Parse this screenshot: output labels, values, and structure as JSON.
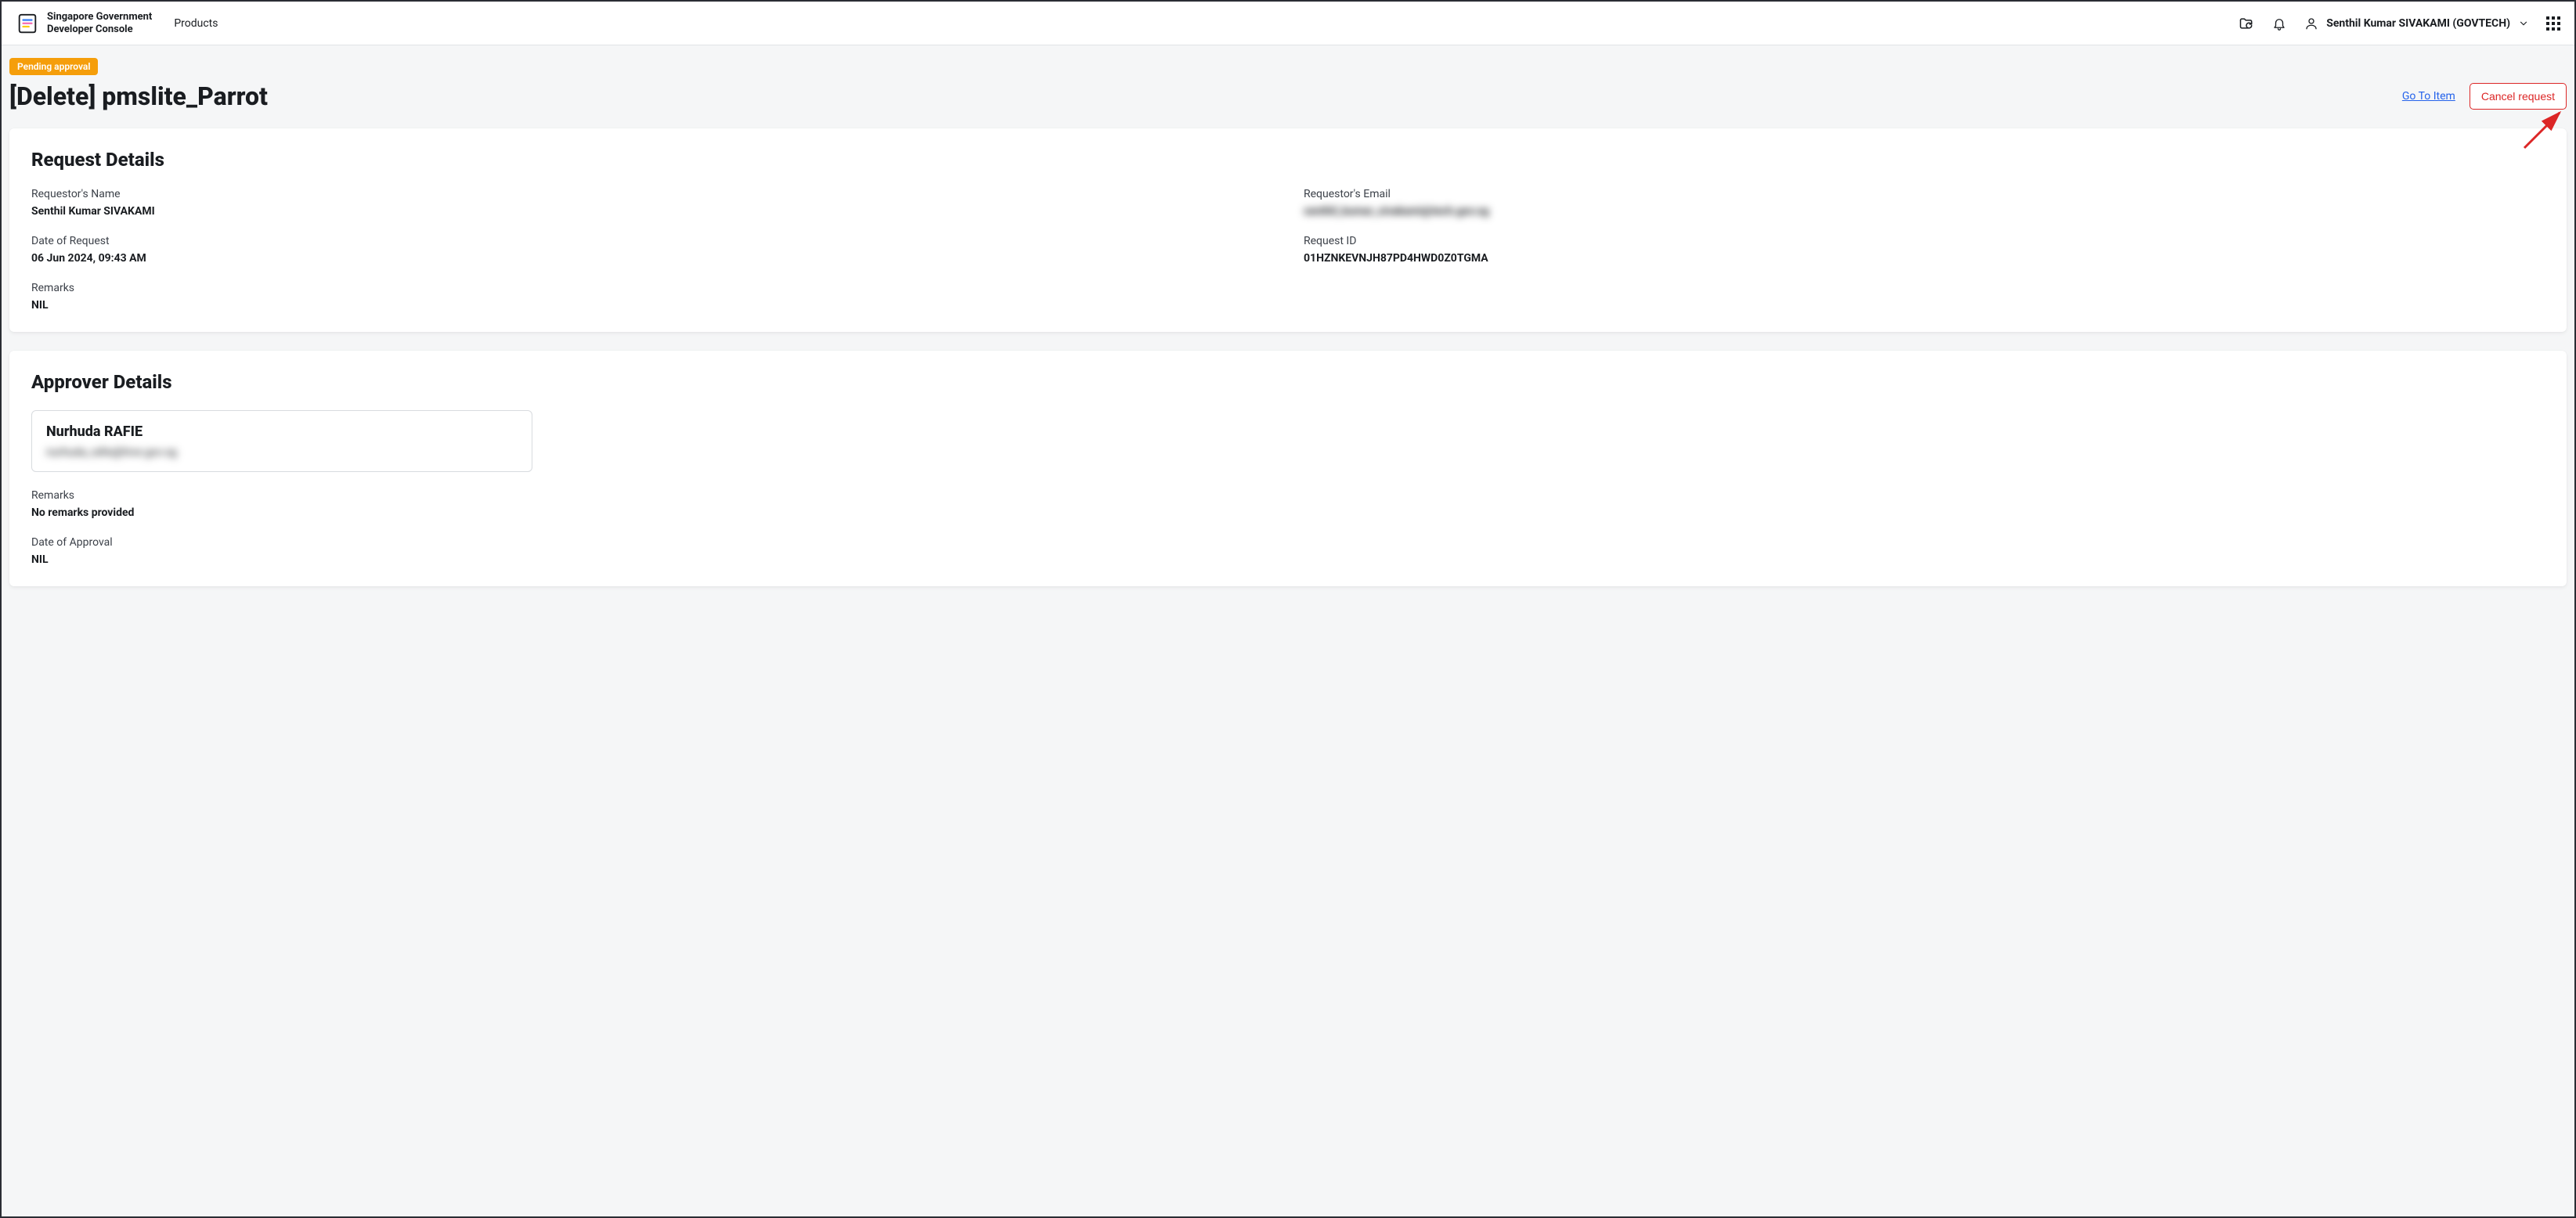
{
  "header": {
    "app_name_line1": "Singapore Government",
    "app_name_line2": "Developer Console",
    "nav_products": "Products",
    "user_name": "Senthil Kumar SIVAKAMI (GOVTECH)"
  },
  "page": {
    "status_badge": "Pending approval",
    "title": "[Delete] pmslite_Parrot",
    "go_to_item": "Go To Item",
    "cancel_request": "Cancel request"
  },
  "request_details": {
    "heading": "Request Details",
    "requestor_name_label": "Requestor's Name",
    "requestor_name_value": "Senthil Kumar SIVAKAMI",
    "requestor_email_label": "Requestor's Email",
    "requestor_email_value": "senthil_kumar_sivakami@tech.gov.sg",
    "date_label": "Date of Request",
    "date_value": "06 Jun 2024, 09:43 AM",
    "request_id_label": "Request ID",
    "request_id_value": "01HZNKEVNJH87PD4HWD0Z0TGMA",
    "remarks_label": "Remarks",
    "remarks_value": "NIL"
  },
  "approver_details": {
    "heading": "Approver Details",
    "approver_name": "Nurhuda RAFIE",
    "approver_email": "nurhuda_rafie@hive.gov.sg",
    "remarks_label": "Remarks",
    "remarks_value": "No remarks provided",
    "date_label": "Date of Approval",
    "date_value": "NIL"
  }
}
